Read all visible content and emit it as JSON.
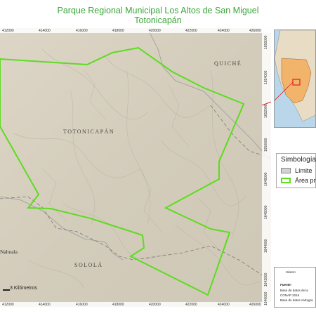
{
  "title": {
    "line1": "Parque Regional Municipal Los Altos de San Miguel",
    "line2": "Totonicapán"
  },
  "map": {
    "x_ticks": [
      "412000",
      "414000",
      "416000",
      "418000",
      "420000",
      "422000",
      "424000",
      "426000"
    ],
    "x_ticks_bottom": [
      "412000",
      "414000",
      "416000",
      "418000",
      "420000",
      "422000",
      "424000",
      "426000"
    ],
    "y_ticks": [
      "1656000",
      "1654000",
      "1652000",
      "1650000",
      "1648000",
      "1646000",
      "1644000",
      "1642000",
      "1640000"
    ],
    "places": {
      "quiche": "QUICHÉ",
      "totonicapan": "TOTONICAPÁN",
      "solola": "SOLOLÁ",
      "nahuala": "Nahuala"
    },
    "scale_label": "3 Kilómetros",
    "colors": {
      "protected_area": "#5ddc1f",
      "admin_limit": "#7a7a7a",
      "terrain": "#d9d2c2"
    }
  },
  "legend": {
    "title": "Simbología",
    "items": [
      {
        "label": "Límite",
        "color": "#b5b5b5"
      },
      {
        "label": "Área pr",
        "color": "#5ddc1f"
      }
    ]
  },
  "source": {
    "heading": "Sistem",
    "label": "Fuente:",
    "lines": [
      "Base de datos de la",
      "CONAP 2016",
      "Base de datos cartogra"
    ]
  }
}
